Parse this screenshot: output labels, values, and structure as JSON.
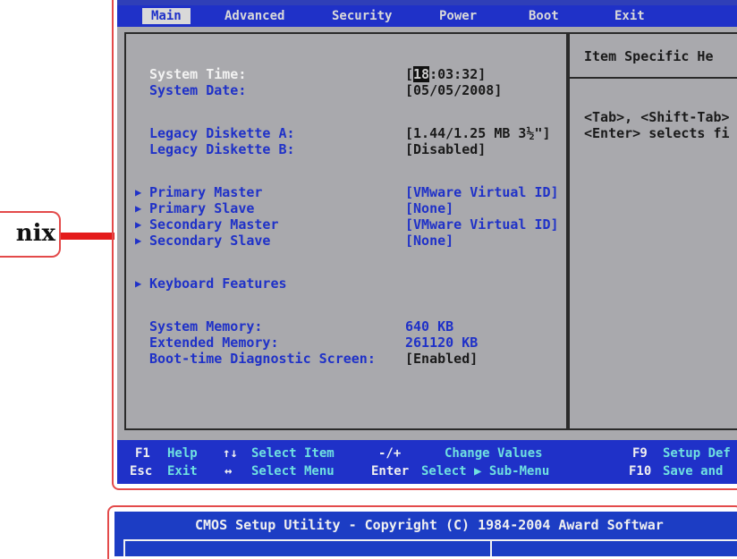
{
  "callout_label": "nix",
  "menubar": {
    "items": [
      {
        "label": "Main",
        "active": true
      },
      {
        "label": "Advanced"
      },
      {
        "label": "Security"
      },
      {
        "label": "Power"
      },
      {
        "label": "Boot"
      },
      {
        "label": "Exit"
      }
    ]
  },
  "main": {
    "system_time_label": "System Time:",
    "system_time_hour": "18",
    "system_time_rest": ":03:32]",
    "system_time_open": "[",
    "system_date_label": "System Date:",
    "system_date_value": "[05/05/2008]",
    "diskette_a_label": "Legacy Diskette A:",
    "diskette_a_value": "[1.44/1.25 MB  3½\"]",
    "diskette_b_label": "Legacy Diskette B:",
    "diskette_b_value": "[Disabled]",
    "primary_master_label": "Primary Master",
    "primary_master_value": "[VMware Virtual ID]",
    "primary_slave_label": "Primary Slave",
    "primary_slave_value": "[None]",
    "secondary_master_label": "Secondary Master",
    "secondary_master_value": "[VMware Virtual ID]",
    "secondary_slave_label": "Secondary Slave",
    "secondary_slave_value": "[None]",
    "keyboard_label": "Keyboard Features",
    "system_memory_label": "System Memory:",
    "system_memory_value": "640 KB",
    "extended_memory_label": "Extended Memory:",
    "extended_memory_value": "261120 KB",
    "diag_label": "Boot-time Diagnostic Screen:",
    "diag_value": "[Enabled]"
  },
  "help": {
    "title": "Item Specific He",
    "line1": "<Tab>, <Shift-Tab>",
    "line2": "<Enter> selects fi"
  },
  "footer": {
    "f1_key": "F1",
    "f1_action": "Help",
    "arrows_key": "↑↓",
    "arrows_action": "Select Item",
    "minusplus_key": "-/+",
    "minusplus_action": "Change Values",
    "f9_key": "F9",
    "f9_action": "Setup Def",
    "esc_key": "Esc",
    "esc_action": "Exit",
    "lr_key": "↔",
    "lr_action": "Select Menu",
    "enter_key": "Enter",
    "enter_action": "Select ▶ Sub-Menu",
    "f10_key": "F10",
    "f10_action": "Save and"
  },
  "award": {
    "title": "CMOS Setup Utility - Copyright (C) 1984-2004 Award Softwar"
  },
  "colors": {
    "bios_blue": "#1f31c8",
    "bios_gray": "#a9a9ad",
    "callout_red": "#e41b1b"
  }
}
